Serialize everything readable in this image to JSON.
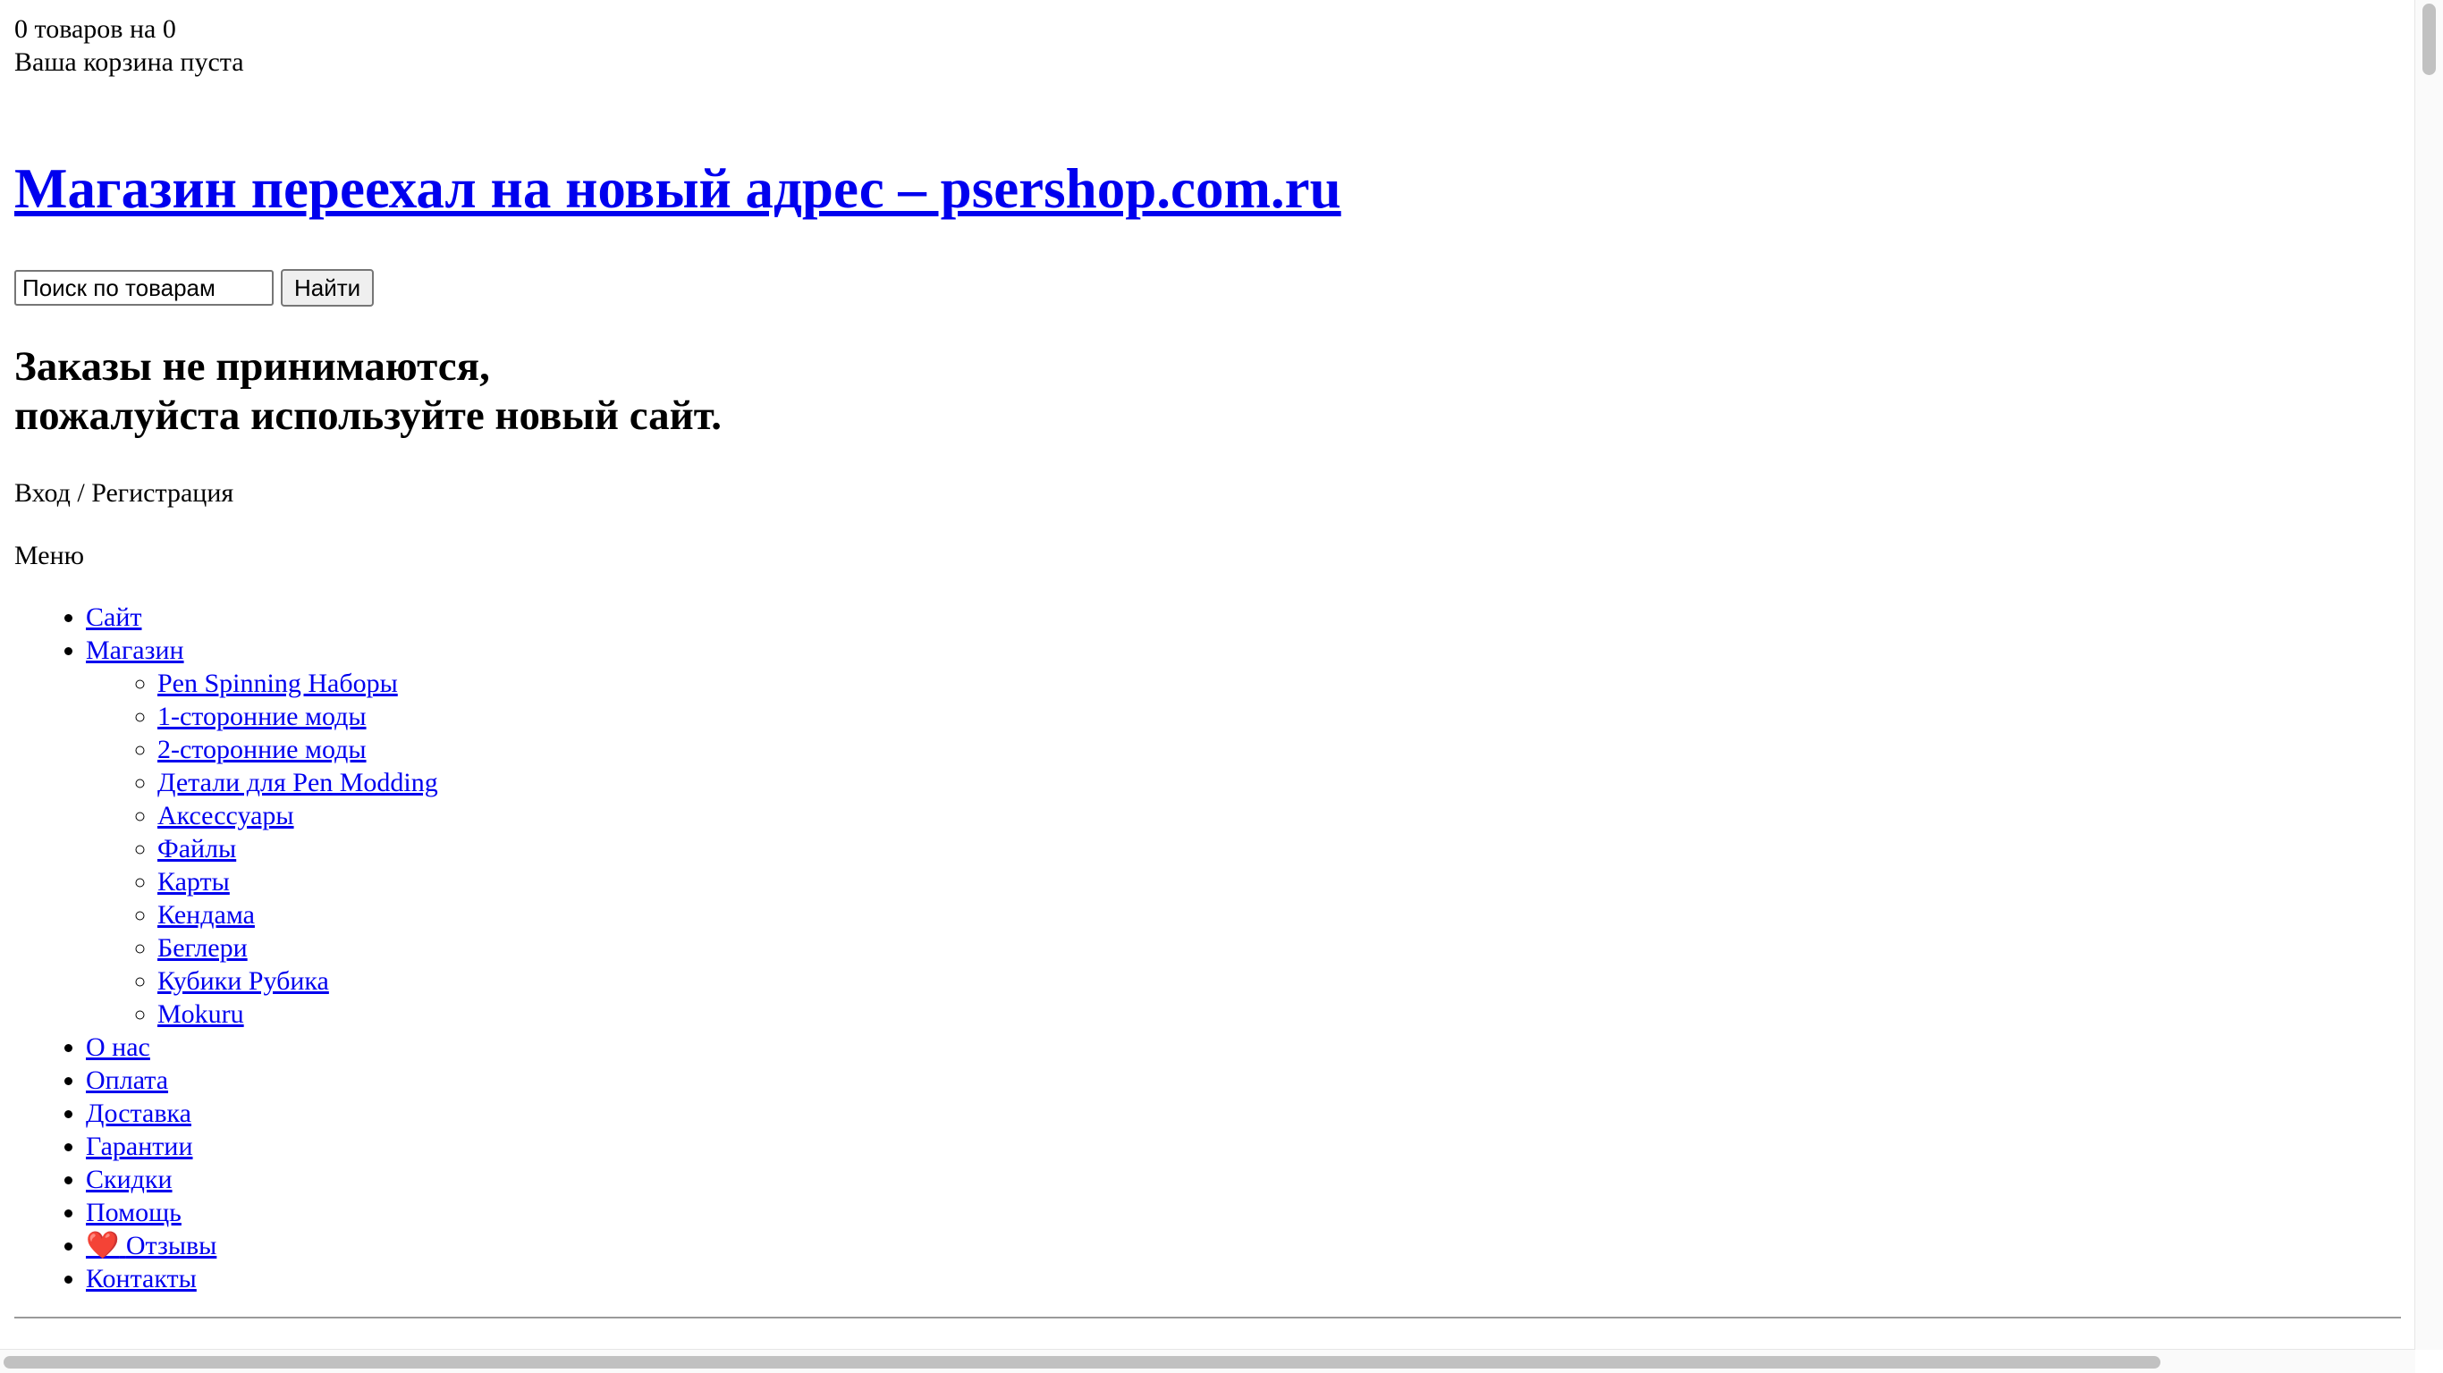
{
  "cart": {
    "summary": "0 товаров на 0",
    "empty_text": "Ваша корзина пуста"
  },
  "header": {
    "site_title": "Магазин переехал на новый адрес – psershop.com.ru"
  },
  "search": {
    "placeholder": "Поиск по товарам",
    "button_label": "Найти"
  },
  "notice": {
    "line1": "Заказы не принимаются,",
    "line2": "пожалуйста используйте новый сайт."
  },
  "account": {
    "label": "Вход / Регистрация"
  },
  "menu": {
    "label": "Меню",
    "items": [
      {
        "label": "Сайт"
      },
      {
        "label": "Магазин",
        "children": [
          {
            "label": "Pen Spinning Наборы"
          },
          {
            "label": "1-сторонние моды"
          },
          {
            "label": "2-сторонние моды"
          },
          {
            "label": "Детали для Pen Modding"
          },
          {
            "label": "Аксессуары"
          },
          {
            "label": "Файлы"
          },
          {
            "label": "Карты"
          },
          {
            "label": "Кендама"
          },
          {
            "label": "Беглери"
          },
          {
            "label": "Кубики Рубика"
          },
          {
            "label": "Mokuru"
          }
        ]
      },
      {
        "label": "О нас"
      },
      {
        "label": "Оплата"
      },
      {
        "label": "Доставка"
      },
      {
        "label": "Гарантии"
      },
      {
        "label": "Скидки"
      },
      {
        "label": "Помощь"
      },
      {
        "label": "Отзывы",
        "icon": "heart-icon",
        "icon_glyph": "❤️"
      },
      {
        "label": "Контакты"
      }
    ]
  },
  "colors": {
    "link": "#0000ee",
    "heart": "#d8203a"
  }
}
